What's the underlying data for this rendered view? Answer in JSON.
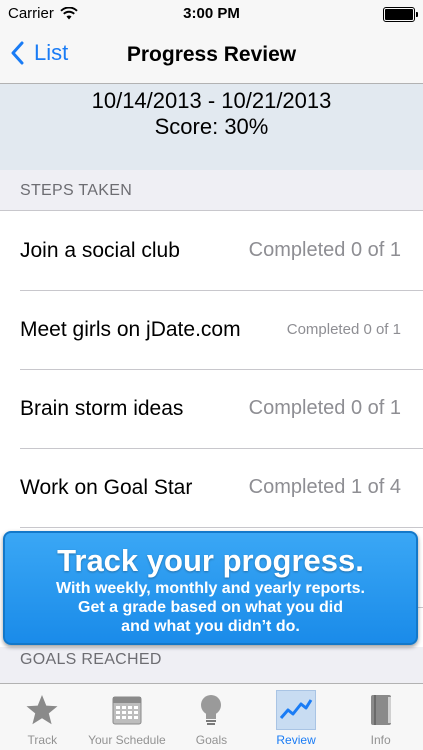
{
  "status_bar": {
    "carrier": "Carrier",
    "time": "3:00 PM"
  },
  "nav": {
    "back_label": "List",
    "title": "Progress Review"
  },
  "summary": {
    "date_range": "10/14/2013 - 10/21/2013",
    "score": "Score:  30%"
  },
  "sections": {
    "steps_taken": "STEPS TAKEN",
    "goals_reached": "GOALS REACHED"
  },
  "steps": [
    {
      "title": "Join a social club",
      "status": "Completed 0 of 1"
    },
    {
      "title": "Meet girls on jDate.com",
      "status": "Completed 0 of 1"
    },
    {
      "title": "Brain storm ideas",
      "status": "Completed 0 of 1"
    },
    {
      "title": "Work on Goal Star",
      "status": "Completed 1 of 4"
    }
  ],
  "promo": {
    "headline": "Track your progress.",
    "line1": "With weekly, monthly and yearly reports.",
    "line2": "Get a grade based on what you did",
    "line3": "and what you didn’t do."
  },
  "tabs": [
    {
      "label": "Track",
      "icon": "star-icon"
    },
    {
      "label": "Your Schedule",
      "icon": "calendar-icon"
    },
    {
      "label": "Goals",
      "icon": "lightbulb-icon"
    },
    {
      "label": "Review",
      "icon": "chart-line-icon",
      "active": true
    },
    {
      "label": "Info",
      "icon": "book-icon"
    }
  ],
  "colors": {
    "accent": "#1a7cf5",
    "promo": "#2a9bf0",
    "summary_bg": "#e2e9f0"
  }
}
